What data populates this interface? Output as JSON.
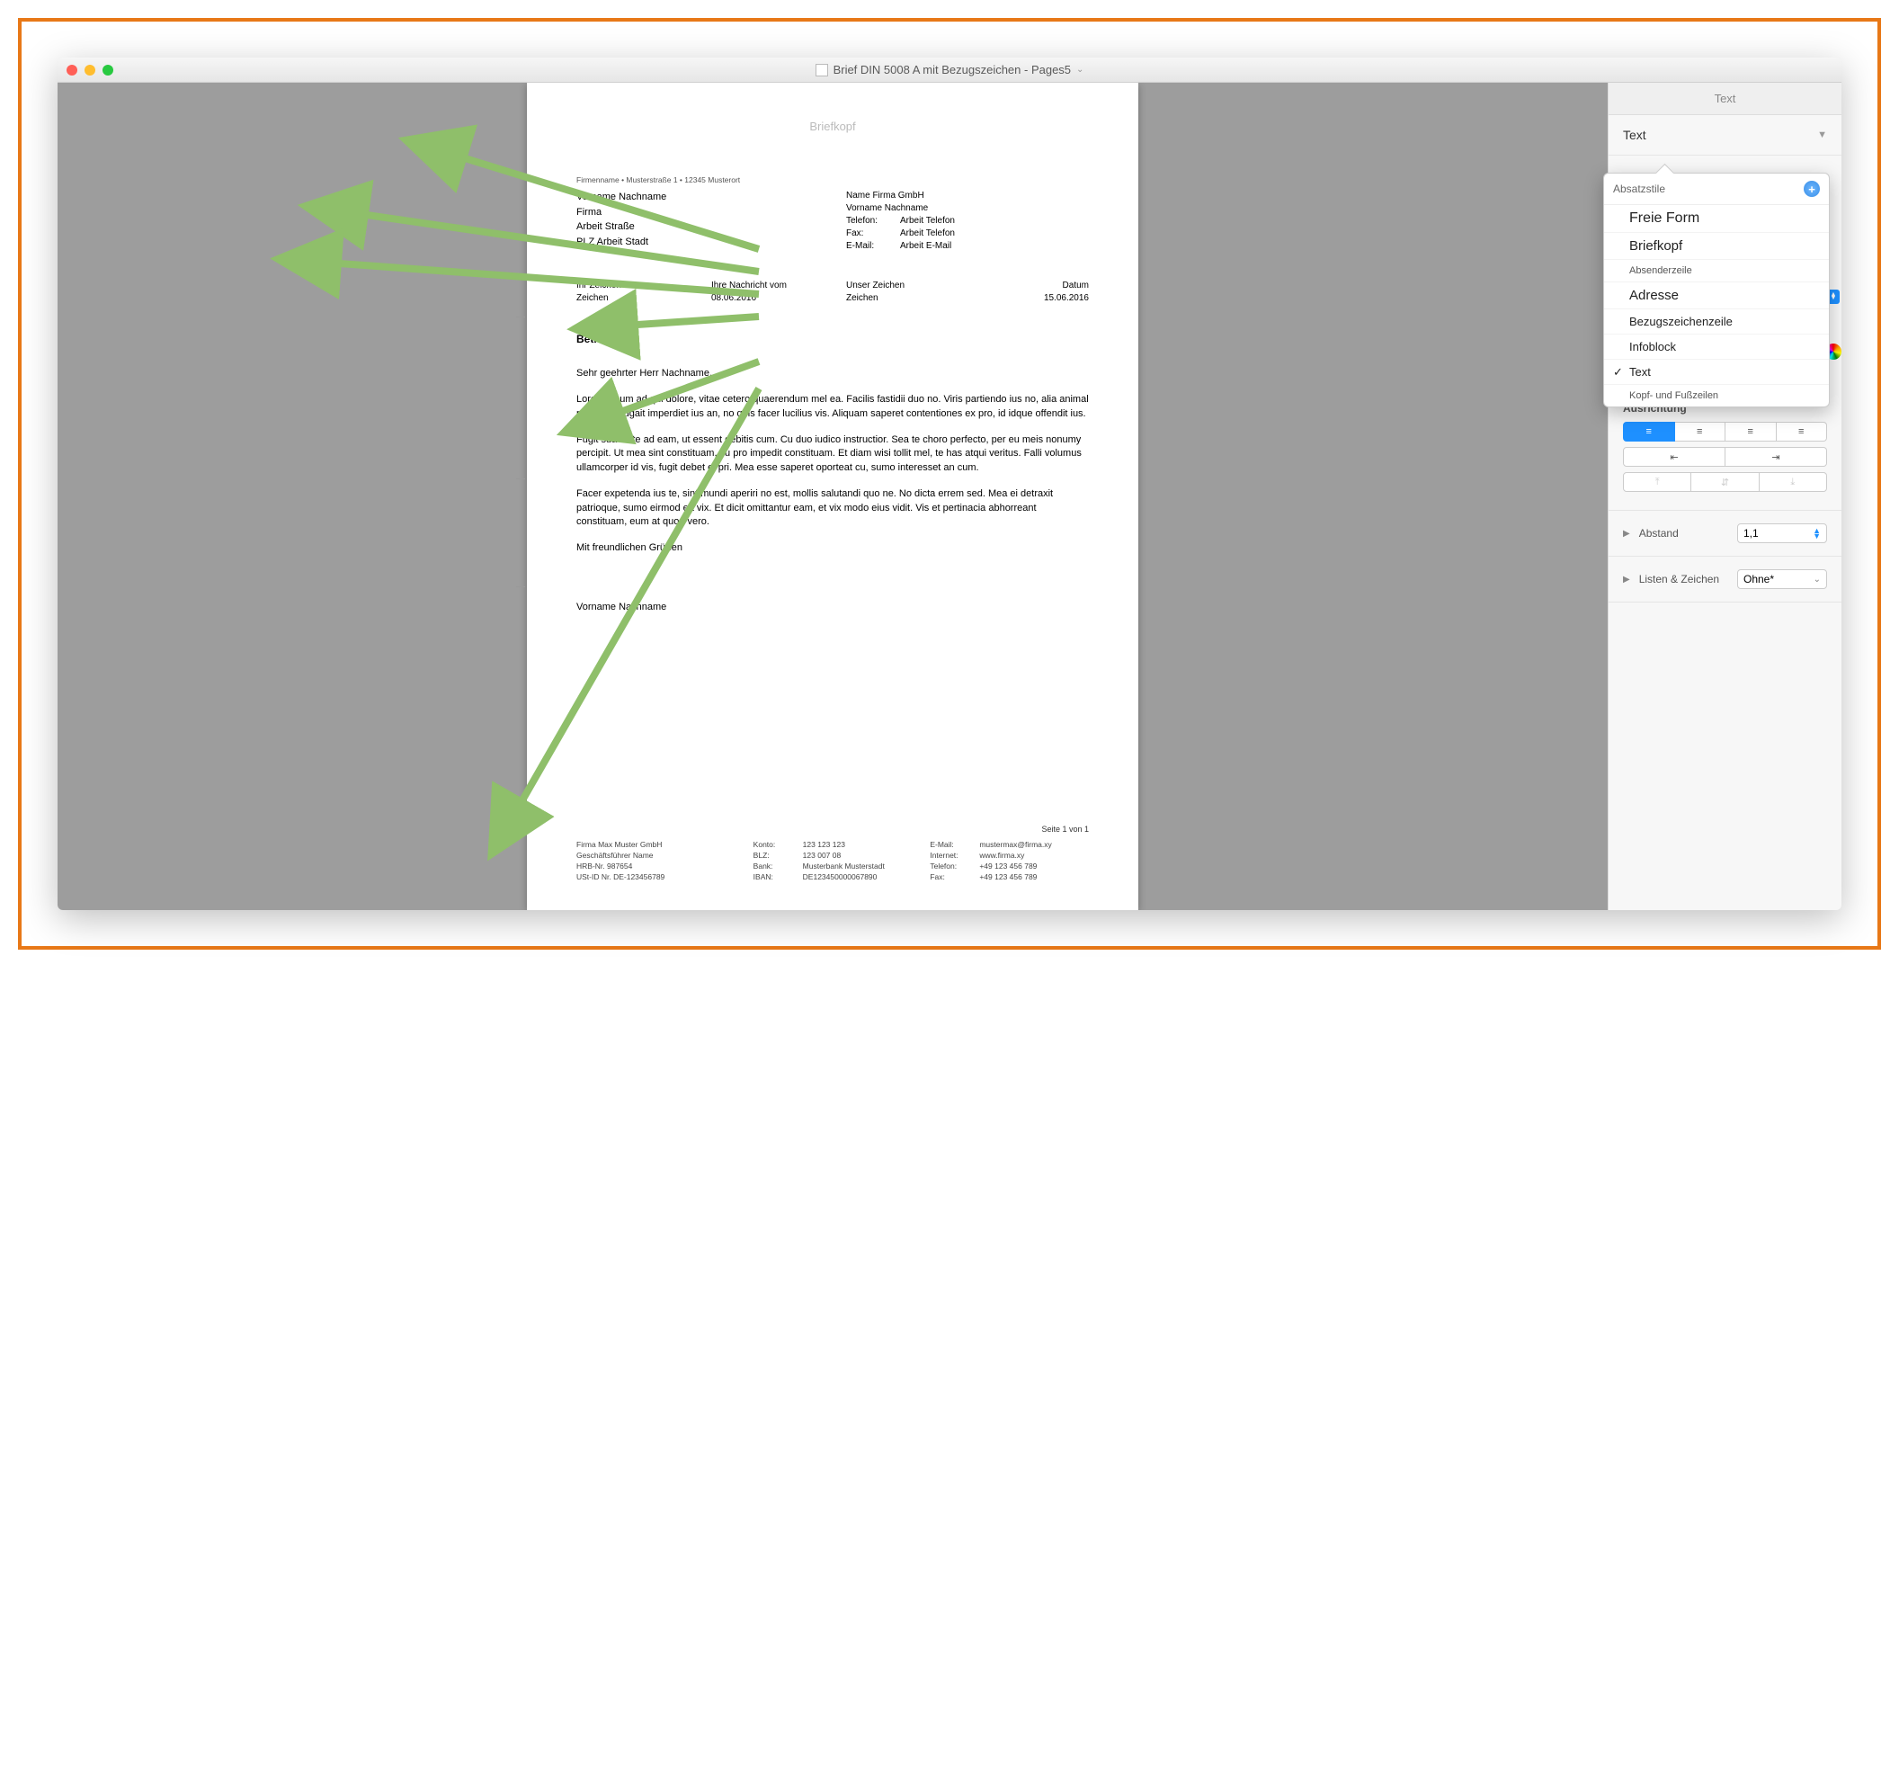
{
  "window": {
    "title": "Brief DIN 5008 A mit Bezugszeichen - Pages5"
  },
  "doc": {
    "briefkopf": "Briefkopf",
    "absender": "Firmenname • Musterstraße 1 • 12345 Musterort",
    "addrLeft": {
      "l1": "Vorname Nachname",
      "l2": "Firma",
      "l3": "Arbeit Straße",
      "l4": "PLZ Arbeit Stadt"
    },
    "addrRight": {
      "company": "Name Firma GmbH",
      "name": "Vorname Nachname",
      "tel_lbl": "Telefon:",
      "tel_val": "Arbeit Telefon",
      "fax_lbl": "Fax:",
      "fax_val": "Arbeit Telefon",
      "mail_lbl": "E-Mail:",
      "mail_val": "Arbeit E-Mail"
    },
    "refs": {
      "c1l": "Ihr Zeichen",
      "c1v": "Zeichen",
      "c2l": "Ihre Nachricht vom",
      "c2v": "08.06.2016",
      "c3l": "Unser Zeichen",
      "c3v": "Zeichen",
      "c4l": "Datum",
      "c4v": "15.06.2016"
    },
    "betreff": "Betreff",
    "anrede": "Sehr geehrter Herr Nachname,",
    "p1": "Lorem ipsum ad qui dolore, vitae cetero quaerendum mel ea. Facilis fastidii duo no. Viris partiendo ius no, alia animal nam at. Feugait imperdiet ius an, no quis facer lucilius vis. Aliquam saperet contentiones ex pro, id idque offendit ius.",
    "p2": "Fugit suavitate ad eam, ut essent debitis cum. Cu duo iudico instructior. Sea te choro perfecto, per eu meis nonumy percipit. Ut mea sint constituam, cu pro impedit constituam. Et diam wisi tollit mel, te has atqui veritus. Falli volumus ullamcorper id vis, fugit debet ei pri. Mea esse saperet oporteat cu, sumo interesset an cum.",
    "p3": "Facer expetenda ius te, sint mundi aperiri no est, mollis salutandi quo ne. No dicta errem sed. Mea ei detraxit patrioque, sumo eirmod ea vix. Et dicit omittantur eam, et vix modo eius vidit. Vis et pertinacia abhorreant constituam, eum at quod vero.",
    "gruss": "Mit freundlichen Grüßen",
    "signame": "Vorname Nachname",
    "pagenum": "Seite 1 von 1",
    "footer": {
      "c1": {
        "l1": "Firma Max Muster GmbH",
        "l2": "Geschäftsführer Name",
        "l3": "HRB-Nr. 987654",
        "l4": "USt-ID Nr. DE-123456789"
      },
      "c2": {
        "r1l": "Konto:",
        "r1v": "123 123 123",
        "r2l": "BLZ:",
        "r2v": "123 007 08",
        "r3l": "Bank:",
        "r3v": "Musterbank Musterstadt",
        "r4l": "IBAN:",
        "r4v": "DE123450000067890"
      },
      "c3": {
        "r1l": "E-Mail:",
        "r1v": "mustermax@firma.xy",
        "r2l": "Internet:",
        "r2v": "www.firma.xy",
        "r3l": "Telefon:",
        "r3v": "+49 123 456 789",
        "r4l": "Fax:",
        "r4v": "+49 123 456 789"
      }
    }
  },
  "sidebar": {
    "tab": "Text",
    "style_label": "Text",
    "popover_title": "Absatzstile",
    "styles": [
      {
        "label": "Freie Form",
        "cls": "big"
      },
      {
        "label": "Briefkopf",
        "cls": "med"
      },
      {
        "label": "Absenderzeile",
        "cls": "sm"
      },
      {
        "label": "Adresse",
        "cls": "med"
      },
      {
        "label": "Bezugszeichenzeile",
        "cls": ""
      },
      {
        "label": "Infoblock",
        "cls": ""
      },
      {
        "label": "Text",
        "cls": "",
        "selected": true
      },
      {
        "label": "Kopf- und Fußzeilen",
        "cls": "sm"
      }
    ],
    "align_label": "Ausrichtung",
    "abstand_label": "Abstand",
    "abstand_value": "1,1",
    "listen_label": "Listen & Zeichen",
    "listen_value": "Ohne*"
  }
}
